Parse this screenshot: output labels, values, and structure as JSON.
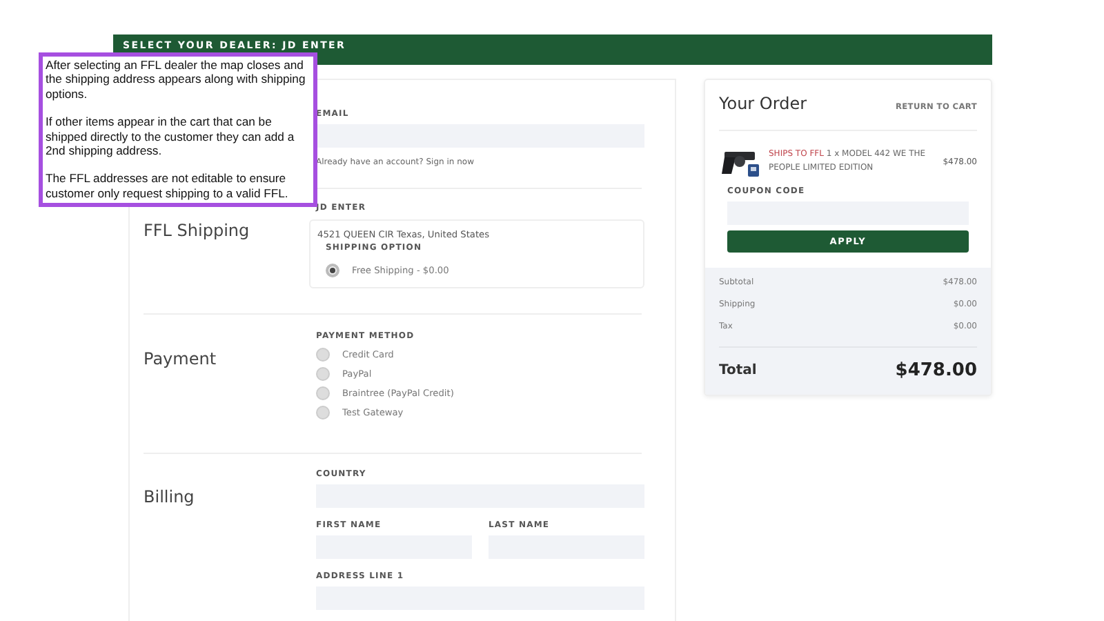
{
  "banner": {
    "text": "SELECT YOUR DEALER: JD ENTER"
  },
  "callout": {
    "paragraphs": [
      "After selecting an FFL dealer the map closes and the shipping address appears along with shipping options.",
      "If other items appear in the cart that can be shipped directly to the customer they can add a 2nd shipping address.",
      "The FFL addresses are not editable to ensure customer only request shipping to a valid FFL."
    ]
  },
  "sections": [
    {
      "kind": "contact",
      "fields": [
        {
          "label": "EMAIL"
        }
      ],
      "note": "Already have an account? Sign in now"
    },
    {
      "kind": "ffl",
      "title": "FFL Shipping",
      "dealer": "JD ENTER",
      "address": "4521 QUEEN CIR Texas, United States",
      "option_label": "SHIPPING OPTION",
      "options": [
        {
          "label": "Free Shipping - $0.00",
          "selected": true
        }
      ]
    },
    {
      "kind": "payment",
      "title": "Payment",
      "option_label": "PAYMENT METHOD",
      "options": [
        {
          "label": "Credit Card",
          "selected": false
        },
        {
          "label": "PayPal",
          "selected": false
        },
        {
          "label": "Braintree (PayPal Credit)",
          "selected": false
        },
        {
          "label": "Test Gateway",
          "selected": false
        }
      ]
    },
    {
      "kind": "billing",
      "title": "Billing",
      "rows": [
        [
          {
            "label": "COUNTRY"
          }
        ],
        [
          {
            "label": "FIRST NAME"
          },
          {
            "label": "LAST NAME"
          }
        ],
        [
          {
            "label": "ADDRESS LINE 1"
          }
        ]
      ]
    }
  ],
  "order": {
    "title": "Your Order",
    "return_link": "RETURN TO CART",
    "item": {
      "kind": "picture",
      "tag": "SHIPS TO FFL",
      "description": "1 x MODEL 442 WE THE PEOPLE LIMITED EDITION",
      "price": "$478.00"
    },
    "coupon_label": "COUPON CODE",
    "apply_button": "APPLY",
    "summary": [
      {
        "label": "Subtotal",
        "value": "$478.00"
      },
      {
        "label": "Shipping",
        "value": "$0.00"
      },
      {
        "label": "Tax",
        "value": "$0.00"
      }
    ],
    "total": {
      "label": "Total",
      "value": "$478.00"
    }
  }
}
